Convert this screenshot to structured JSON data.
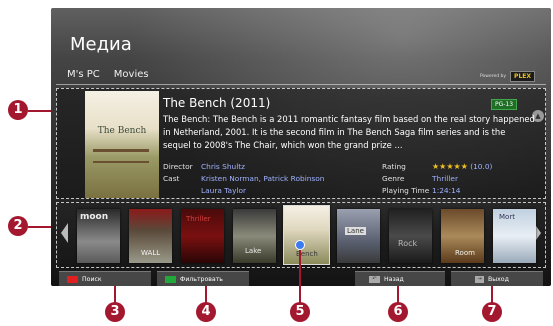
{
  "screen": {
    "title": "Медиа",
    "breadcrumbs": [
      "M's PC",
      "Movies"
    ],
    "powered_by": "Powered by",
    "powered_logo": "PLEX"
  },
  "movie": {
    "title": "The Bench (2011)",
    "age_rating": "PG-13",
    "poster_text": "The Bench",
    "description": "The Bench: The Bench is a 2011 romantic fantasy film based on the real story happened in Netherland, 2001. It is the second film in The Bench Saga film series and is the sequel to 2008's The Chair, which won the grand prize ...",
    "director_label": "Director",
    "director": "Chris Shultz",
    "cast_label": "Cast",
    "cast_line1": "Kristen Norman, Patrick Robinson",
    "cast_line2": "Laura Taylor",
    "rating_label": "Rating",
    "rating_stars": "★★★★★",
    "rating_value": "(10.0)",
    "genre_label": "Genre",
    "genre": "Thriller",
    "playing_time_label": "Playing Time",
    "playing_time": "1:24:14"
  },
  "thumbnails": [
    {
      "text": "moon"
    },
    {
      "text": "WALL"
    },
    {
      "text": "Thriller"
    },
    {
      "text": "Lake"
    },
    {
      "text": "Bench"
    },
    {
      "text": "Lane"
    },
    {
      "text": "Rock"
    },
    {
      "text": "Room"
    },
    {
      "text": "Mort"
    }
  ],
  "buttons": {
    "search": "Поиск",
    "filter": "Фильтровать",
    "back": "Назад",
    "exit": "Выход"
  },
  "callouts": [
    "1",
    "2",
    "3",
    "4",
    "5",
    "6",
    "7"
  ],
  "colors": {
    "callout": "#a3182e",
    "search_key": "#e02020",
    "filter_key": "#22a83a",
    "link_text": "#9fb2ff",
    "star": "#f0c020",
    "selection_dot": "#3b7aef"
  }
}
